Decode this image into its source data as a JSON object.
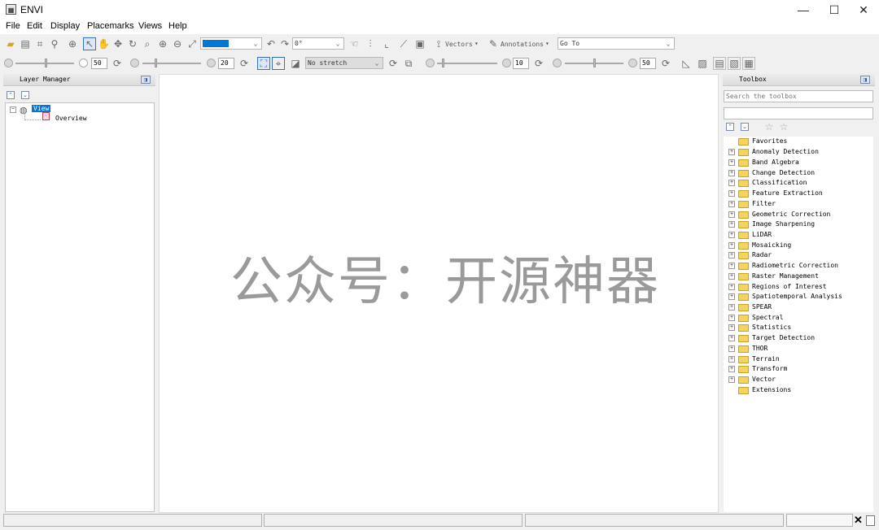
{
  "window": {
    "title": "ENVI",
    "icon": "envi-app-icon",
    "controls": {
      "minimize": "—",
      "maximize": "☐",
      "close": "✕"
    }
  },
  "menubar": {
    "items": [
      "File",
      "Edit",
      "Display",
      "Placemarks",
      "Views",
      "Help"
    ]
  },
  "toolbar1": {
    "rotation_value": "0°",
    "vectors_label": "Vectors",
    "annotations_label": "Annotations",
    "goto_placeholder": "Go To"
  },
  "toolbar2": {
    "brightness_value": "50",
    "contrast_value": "20",
    "stretch_value": "No stretch",
    "sharpen_value": "10",
    "transparency_value": "50"
  },
  "layer_manager": {
    "title": "Layer Manager",
    "tree": {
      "root": "View",
      "child": "Overview"
    }
  },
  "toolbox": {
    "title": "Toolbox",
    "search_placeholder": "Search the toolbox",
    "items": [
      {
        "label": "Favorites",
        "expandable": false
      },
      {
        "label": "Anomaly Detection",
        "expandable": true
      },
      {
        "label": "Band Algebra",
        "expandable": true
      },
      {
        "label": "Change Detection",
        "expandable": true
      },
      {
        "label": "Classification",
        "expandable": true
      },
      {
        "label": "Feature Extraction",
        "expandable": true
      },
      {
        "label": "Filter",
        "expandable": true
      },
      {
        "label": "Geometric Correction",
        "expandable": true
      },
      {
        "label": "Image Sharpening",
        "expandable": true
      },
      {
        "label": "LiDAR",
        "expandable": true
      },
      {
        "label": "Mosaicking",
        "expandable": true
      },
      {
        "label": "Radar",
        "expandable": true
      },
      {
        "label": "Radiometric Correction",
        "expandable": true
      },
      {
        "label": "Raster Management",
        "expandable": true
      },
      {
        "label": "Regions of Interest",
        "expandable": true
      },
      {
        "label": "Spatiotemporal Analysis",
        "expandable": true
      },
      {
        "label": "SPEAR",
        "expandable": true
      },
      {
        "label": "Spectral",
        "expandable": true
      },
      {
        "label": "Statistics",
        "expandable": true
      },
      {
        "label": "Target Detection",
        "expandable": true
      },
      {
        "label": "THOR",
        "expandable": true
      },
      {
        "label": "Terrain",
        "expandable": true
      },
      {
        "label": "Transform",
        "expandable": true
      },
      {
        "label": "Vector",
        "expandable": true
      },
      {
        "label": "Extensions",
        "expandable": false
      }
    ]
  },
  "watermark": "公众号：开源神器",
  "colors": {
    "selection": "#0078d7",
    "folder": "#f4d35e"
  }
}
